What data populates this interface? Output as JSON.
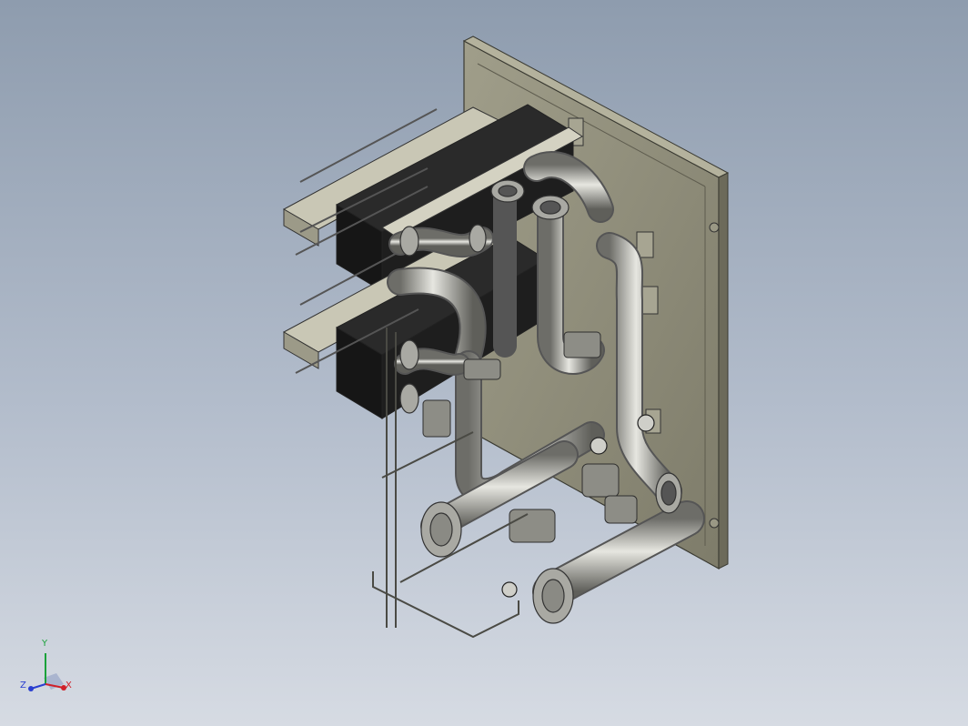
{
  "triad": {
    "x_label": "X",
    "y_label": "Y",
    "z_label": "Z",
    "x_color": "#d0202a",
    "y_color": "#1aa23a",
    "z_color": "#2a3fd0"
  },
  "colors": {
    "background_top": "#8e9cae",
    "background_bottom": "#d6dbe3",
    "frame": "#8f8d7a",
    "plates": "#1e1e1e",
    "pipe": "#b8b8b2"
  }
}
